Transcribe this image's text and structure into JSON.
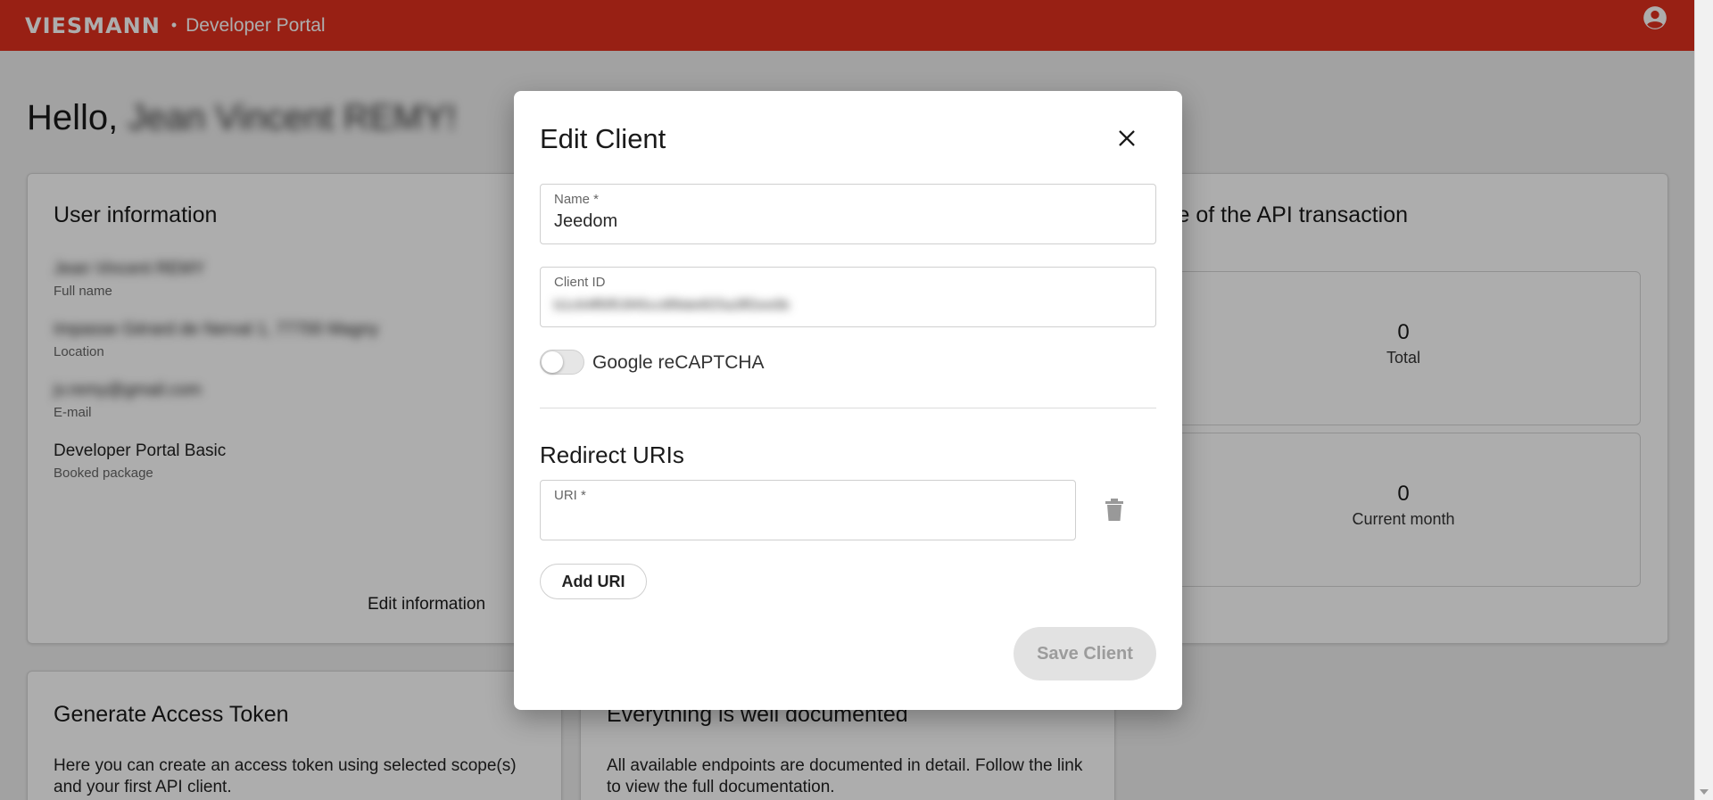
{
  "header": {
    "logo_text": "VIESMANN",
    "separator": "•",
    "portal_title": "Developer Portal"
  },
  "greeting": {
    "prefix": "Hello,",
    "name": "Jean Vincent REMY!"
  },
  "user_info": {
    "title": "User information",
    "items": [
      {
        "value": "Jean Vincent REMY",
        "label": "Full name"
      },
      {
        "value": "Impasse Gérard de Nerval 1, 77700 Magny",
        "label": "Location"
      },
      {
        "value": "jv.remy@gmail.com",
        "label": "E-mail"
      },
      {
        "value": "Developer Portal Basic",
        "label": "Booked package"
      }
    ],
    "edit_label": "Edit information"
  },
  "api_usage": {
    "title": "se of the API transaction",
    "total": {
      "value": "0",
      "label": "Total"
    },
    "current_month": {
      "value": "0",
      "label": "Current month"
    }
  },
  "access_token_card": {
    "title": "Generate Access Token",
    "text": "Here you can create an access token using selected scope(s) and your first API client."
  },
  "docs_card": {
    "title": "Everything is well documented",
    "text": "All available endpoints are documented in detail. Follow the link to view the full documentation."
  },
  "modal": {
    "title": "Edit Client",
    "name_label": "Name *",
    "name_value": "Jeedom",
    "client_id_label": "Client ID",
    "client_id_value": "b1c64ff0f53f45cc8f9de6f25a3ff2ee0b",
    "recaptcha_label": "Google reCAPTCHA",
    "recaptcha_enabled": false,
    "redirect_title": "Redirect URIs",
    "uri_label": "URI *",
    "uri_value": "",
    "add_uri_label": "Add URI",
    "save_label": "Save Client"
  },
  "colors": {
    "brand": "#e0301e",
    "overlay": "rgba(0,0,0,0.32)"
  }
}
